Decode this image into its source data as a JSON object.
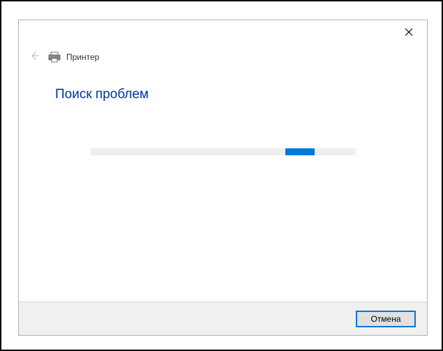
{
  "header": {
    "title": "Принтер"
  },
  "content": {
    "status_heading": "Поиск проблем"
  },
  "footer": {
    "cancel_label": "Отмена"
  },
  "colors": {
    "accent": "#0078d7",
    "heading": "#003399"
  }
}
